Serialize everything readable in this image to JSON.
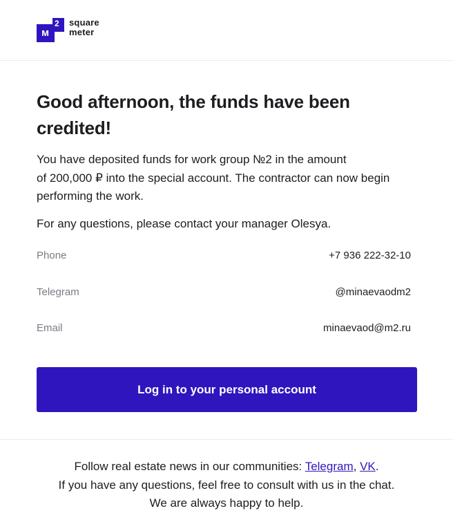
{
  "brand": {
    "mark_letter": "м",
    "mark_sup": "2",
    "name_line1": "square",
    "name_line2": "meter",
    "accent_color": "#2f15bd"
  },
  "message": {
    "title_line1": "Good afternoon, the funds have been",
    "title_line2": "credited!",
    "paragraph1_line1": "You have deposited funds for work group №2 in the amount",
    "paragraph1_line2": "of 200,000 ₽ into the special account. The contractor can now begin",
    "paragraph1_line3": "performing the work.",
    "paragraph2": "For any questions, please contact your manager Olesya."
  },
  "contacts": [
    {
      "label": "Phone",
      "value": "+7 936 222-32-10"
    },
    {
      "label": "Telegram",
      "value": "@minaevaodm2"
    },
    {
      "label": "Email",
      "value": "minaevaod@m2.ru"
    }
  ],
  "cta": {
    "label": "Log in to your personal account"
  },
  "footer": {
    "line1_prefix": "Follow real estate news in our communities: ",
    "telegram_link": "Telegram",
    "separator": ", ",
    "vk_link": "VK",
    "line1_suffix": ".",
    "line2": "If you have any questions, feel free to consult with us in the chat.",
    "line3": "We are always happy to help."
  }
}
